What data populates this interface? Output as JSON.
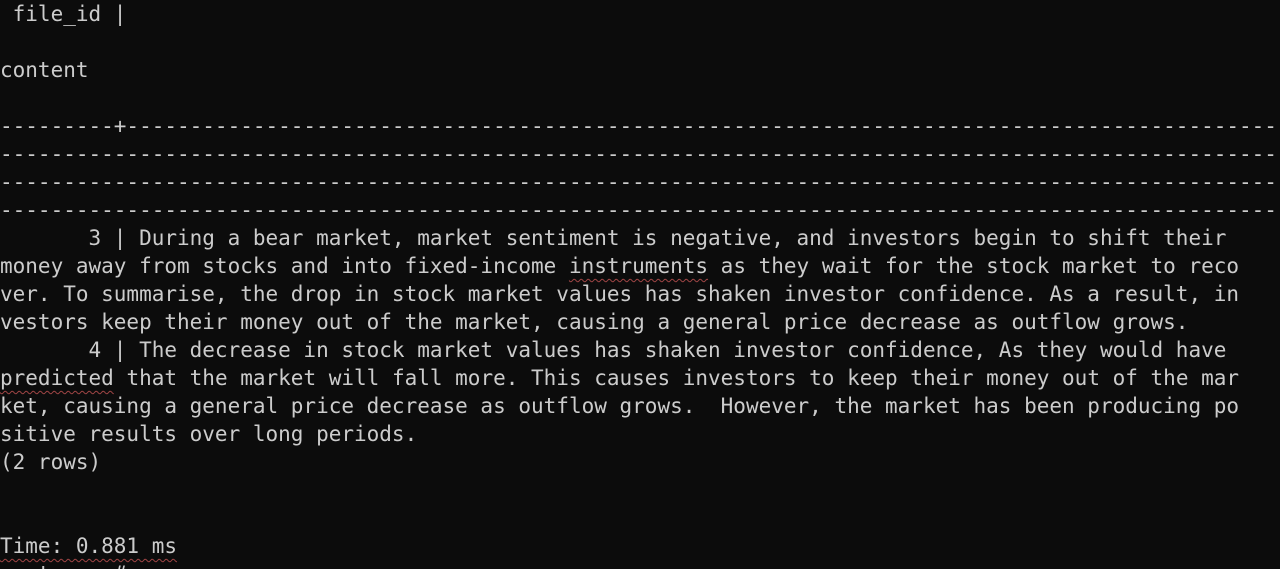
{
  "terminal": {
    "lines": [
      " file_id |",
      "",
      "content",
      "",
      "---------+---------------------------------------------------------------------------------------------------------------------",
      "-----------------------------------------------------------------------------------------------------------------------------------",
      "-----------------------------------------------------------------------------------------------------------------------------------",
      "-------------------------------------------------------------------------------------------------------------------------------",
      "       3 | During a bear market, market sentiment is negative, and investors begin to shift their",
      "money away from stocks and into fixed-income ",
      "ver. To summarise, the drop in stock market values has shaken investor confidence. As a result, in",
      "vestors keep their money out of the market, causing a general price decrease as outflow grows.",
      "       4 | The decrease in stock market values has shaken investor confidence, As they would have",
      "",
      "ket, causing a general price decrease as outflow grows.  However, the market has been producing po",
      "sitive results over long periods.",
      "(2 rows)",
      "",
      "",
      "",
      "postgres=#"
    ],
    "line9_squiggle_word": "instruments",
    "line9_rest": " as they wait for the stock market to reco",
    "line13_squiggle_word": "predicted",
    "line13_rest": " that the market will fall more. This causes investors to keep their money out of the mar",
    "line19_squiggle_word": "Time: 0.881 ms",
    "underline_color": "#a04545",
    "background_color": "#0c0c0c",
    "text_color": "#cccccc"
  }
}
